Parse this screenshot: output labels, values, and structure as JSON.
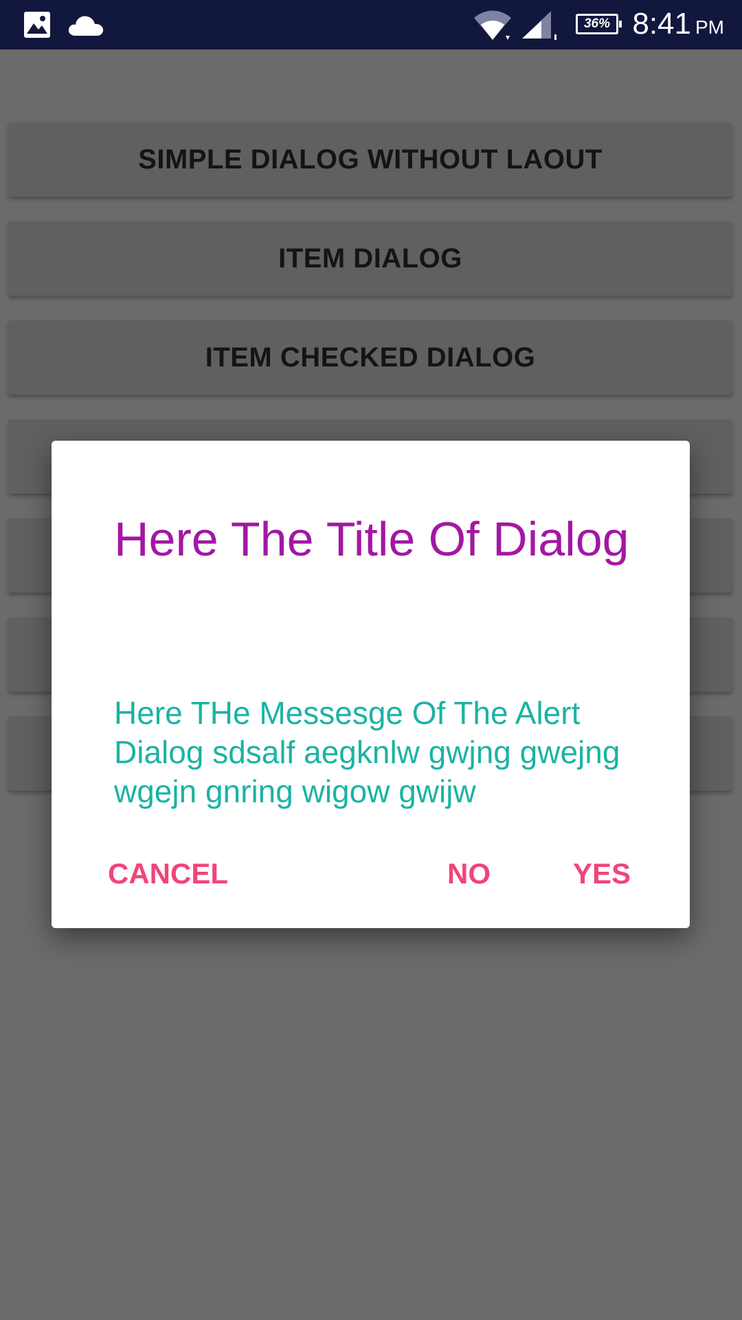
{
  "status_bar": {
    "time": "8:41",
    "ampm": "PM",
    "battery": "36%",
    "icons": [
      "gallery-icon",
      "cloud-icon",
      "wifi-icon",
      "cell-signal-icon"
    ],
    "background_color": "#12173d"
  },
  "screen": {
    "buttons": [
      {
        "label": "SIMPLE DIALOG WITHOUT LAOUT"
      },
      {
        "label": "ITEM DIALOG"
      },
      {
        "label": "ITEM CHECKED DIALOG"
      },
      {
        "label": ""
      },
      {
        "label": ""
      },
      {
        "label": ""
      },
      {
        "label": ""
      }
    ]
  },
  "dialog": {
    "title": "Here The Title Of Dialog",
    "message": "Here THe Messesge Of The Alert Dialog sdsalf aegknlw gwjng gwejng wgejn gnring wigow gwijw",
    "cancel_label": "CANCEL",
    "no_label": "NO",
    "yes_label": "YES",
    "title_color": "#a317a3",
    "message_color": "#1bb3a3",
    "button_color": "#f0457a"
  }
}
